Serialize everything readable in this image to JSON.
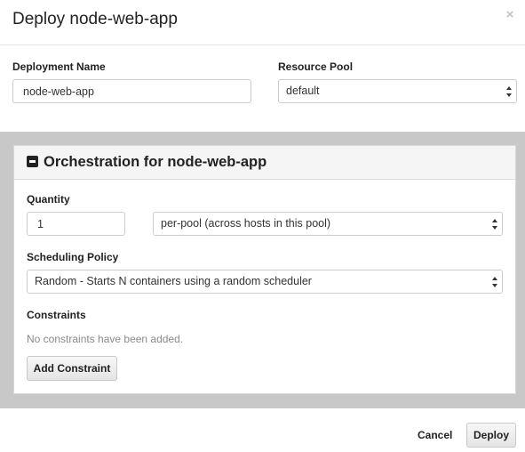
{
  "dialog": {
    "title": "Deploy node-web-app",
    "close_glyph": "×"
  },
  "form": {
    "deployment_name": {
      "label": "Deployment Name",
      "value": "node-web-app"
    },
    "resource_pool": {
      "label": "Resource Pool",
      "selected": "default"
    }
  },
  "orchestration": {
    "title": "Orchestration for node-web-app",
    "quantity": {
      "label": "Quantity",
      "value": "1",
      "mode_selected": "per-pool (across hosts in this pool)"
    },
    "scheduling_policy": {
      "label": "Scheduling Policy",
      "selected": "Random - Starts N containers using a random scheduler"
    },
    "constraints": {
      "label": "Constraints",
      "empty_message": "No constraints have been added.",
      "add_button": "Add Constraint"
    }
  },
  "footer": {
    "cancel_label": "Cancel",
    "deploy_label": "Deploy"
  },
  "icons": {
    "close": "close-icon",
    "collapse": "minus-square-icon",
    "select_arrows": "updown-chevron-icon"
  },
  "colors": {
    "band_background": "#c8c8c8",
    "panel_heading": "#f5f5f5",
    "muted_text": "#8a8a8a"
  }
}
